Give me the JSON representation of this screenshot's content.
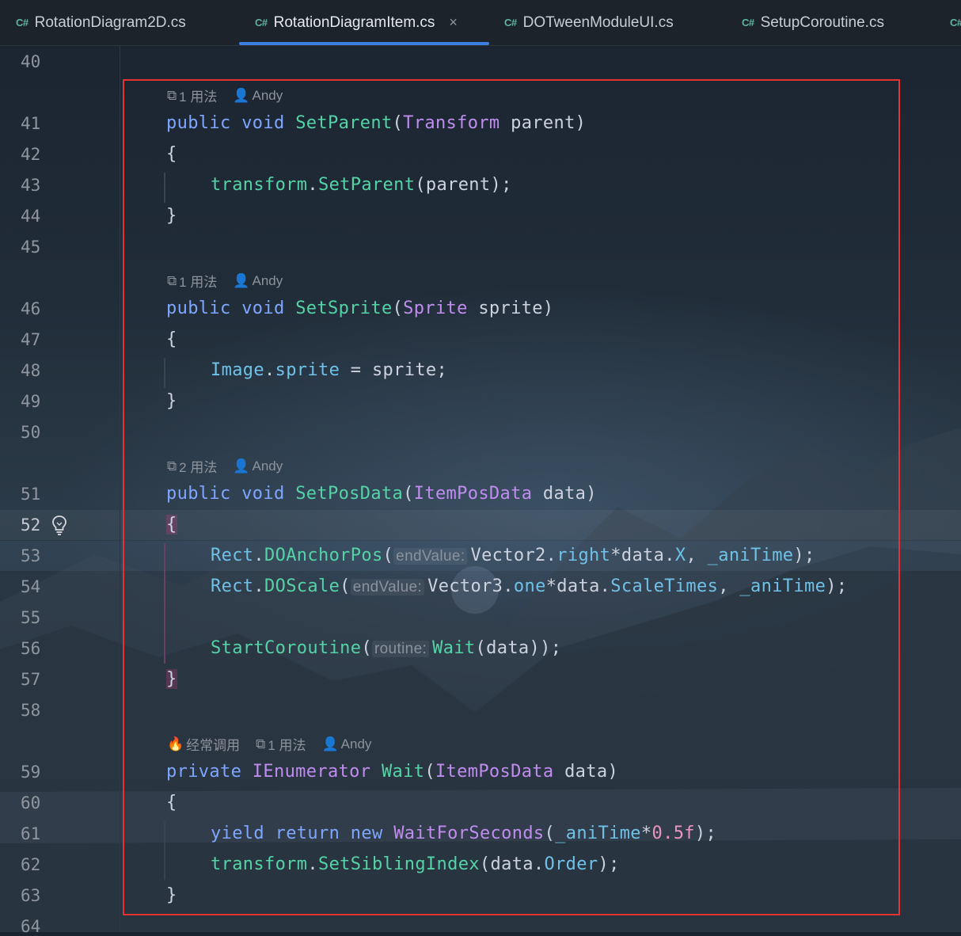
{
  "tabs": [
    {
      "lang": "C#",
      "label": "RotationDiagram2D.cs",
      "active": false
    },
    {
      "lang": "C#",
      "label": "RotationDiagramItem.cs",
      "active": true,
      "close": "×"
    },
    {
      "lang": "C#",
      "label": "DOTweenModuleUI.cs",
      "active": false
    },
    {
      "lang": "C#",
      "label": "SetupCoroutine.cs",
      "active": false
    },
    {
      "lang": "C#",
      "label": "",
      "active": false
    }
  ],
  "line_numbers": [
    "40",
    "41",
    "42",
    "43",
    "44",
    "45",
    "46",
    "47",
    "48",
    "49",
    "50",
    "51",
    "52",
    "53",
    "54",
    "55",
    "56",
    "57",
    "58",
    "59",
    "60",
    "61",
    "62",
    "63",
    "64"
  ],
  "code_lens": {
    "setparent": {
      "usages": "1 用法",
      "author": "Andy"
    },
    "setsprite": {
      "usages": "1 用法",
      "author": "Andy"
    },
    "setposdata": {
      "usages": "2 用法",
      "author": "Andy"
    },
    "wait": {
      "frequent": "经常调用",
      "usages": "1 用法",
      "author": "Andy"
    }
  },
  "code": {
    "l41": {
      "t1": "public",
      "t2": "void",
      "t3": "SetParent",
      "t4": "(",
      "t5": "Transform",
      "t6": " parent)"
    },
    "l42": "{",
    "l43": {
      "t1": "transform",
      "t2": ".",
      "t3": "SetParent",
      "t4": "(parent);"
    },
    "l44": "}",
    "l46": {
      "t1": "public",
      "t2": "void",
      "t3": "SetSprite",
      "t4": "(",
      "t5": "Sprite",
      "t6": " sprite)"
    },
    "l47": "{",
    "l48": {
      "t1": "Image",
      "t2": ".",
      "t3": "sprite",
      "t4": " = sprite;"
    },
    "l49": "}",
    "l51": {
      "t1": "public",
      "t2": "void",
      "t3": "SetPosData",
      "t4": "(",
      "t5": "ItemPosData",
      "t6": " data)"
    },
    "l52": "{",
    "l53": {
      "t1": "Rect",
      "t2": ".",
      "t3": "DOAnchorPos",
      "t4": "(",
      "hint": "endValue:",
      "t5": "Vector2",
      "t6": ".",
      "t7": "right",
      "t8": "*data.",
      "t9": "X",
      "t10": ", ",
      "t11": "_aniTime",
      "t12": ");"
    },
    "l54": {
      "t1": "Rect",
      "t2": ".",
      "t3": "DOScale",
      "t4": "(",
      "hint": "endValue:",
      "t5": "Vector3",
      "t6": ".",
      "t7": "one",
      "t8": "*data.",
      "t9": "ScaleTimes",
      "t10": ", ",
      "t11": "_aniTime",
      "t12": ");"
    },
    "l56": {
      "t1": "StartCoroutine",
      "t2": "(",
      "hint": "routine:",
      "t3": "Wait",
      "t4": "(data));"
    },
    "l57": "}",
    "l59": {
      "t1": "private",
      "t2": "IEnumerator",
      "t3": "Wait",
      "t4": "(",
      "t5": "ItemPosData",
      "t6": " data)"
    },
    "l60": "{",
    "l61": {
      "t1": "yield",
      "t2": "return",
      "t3": "new",
      "t4": "WaitForSeconds",
      "t5": "(",
      "t6": "_aniTime",
      "t7": "*",
      "t8": "0.5f",
      "t9": ");"
    },
    "l62": {
      "t1": "transform",
      "t2": ".",
      "t3": "SetSiblingIndex",
      "t4": "(data.",
      "t5": "Order",
      "t6": ");"
    },
    "l63": "}"
  },
  "colors": {
    "accent": "#3d7fe0",
    "selection_box": "#e53333",
    "keyword": "#7fa6ff",
    "type": "#c18cf0",
    "method": "#54d3a6",
    "field": "#6fc1e8",
    "number": "#ed94c0"
  }
}
